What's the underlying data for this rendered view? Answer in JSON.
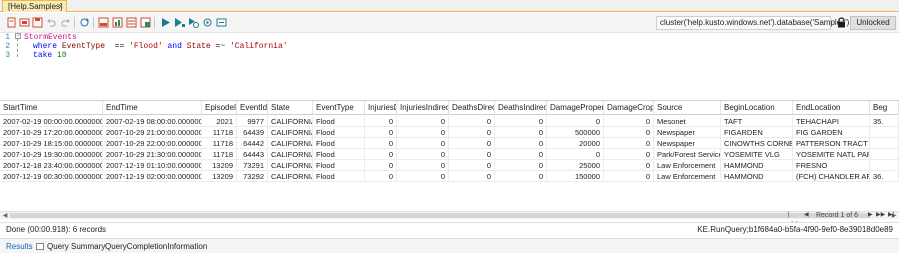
{
  "tab": {
    "title": "[Help.Samples]",
    "close": "×"
  },
  "toolbar": {
    "icons": [
      "new-query-icon",
      "open-icon",
      "save-icon",
      "undo-icon",
      "redo-icon",
      "refresh-icon",
      "export-icon",
      "chart-icon",
      "csv-icon",
      "excel-icon",
      "run-icon",
      "run-selection-icon",
      "run-explain-icon",
      "sync-icon",
      "settings-icon"
    ],
    "connection": "cluster('help.kusto.windows.net').database('Samples')",
    "unlock_label": "Unlocked"
  },
  "editor": {
    "line_numbers": [
      "1",
      "2",
      "3"
    ],
    "line1": {
      "table": "StormEvents"
    },
    "line2": {
      "kw_where": "where",
      "col1": "EventType",
      "op1": "==",
      "str1": "'Flood'",
      "kw_and": "and",
      "col2": "State",
      "op2": "=~",
      "str2": "'California'"
    },
    "line3": {
      "kw_take": "take",
      "num": "10"
    }
  },
  "grid": {
    "columns": [
      "StartTime",
      "EndTime",
      "EpisodeId",
      "EventId",
      "State",
      "EventType",
      "InjuriesDirect",
      "InjuriesIndirect",
      "DeathsDirect",
      "DeathsIndirect",
      "DamageProperty",
      "DamageCrops",
      "Source",
      "BeginLocation",
      "EndLocation",
      "Beg"
    ],
    "rows": [
      [
        "2007-02-19 00:00:00.0000000",
        "2007-02-19 08:00:00.0000000",
        "2021",
        "9977",
        "CALIFORNIA",
        "Flood",
        "0",
        "0",
        "0",
        "0",
        "0",
        "0",
        "Mesonet",
        "TAFT",
        "TEHACHAPI",
        "35."
      ],
      [
        "2007-10-29 17:20:00.0000000",
        "2007-10-29 21:00:00.0000000",
        "11718",
        "64439",
        "CALIFORNIA",
        "Flood",
        "0",
        "0",
        "0",
        "0",
        "500000",
        "0",
        "Newspaper",
        "FIGARDEN",
        "FIG GARDEN",
        ""
      ],
      [
        "2007-10-29 18:15:00.0000000",
        "2007-10-29 22:00:00.0000000",
        "11718",
        "64442",
        "CALIFORNIA",
        "Flood",
        "0",
        "0",
        "0",
        "0",
        "20000",
        "0",
        "Newspaper",
        "CINOWTHS CORNER",
        "PATTERSON TRACT",
        ""
      ],
      [
        "2007-10-29 19:30:00.0000000",
        "2007-10-29 21:30:00.0000000",
        "11718",
        "64443",
        "CALIFORNIA",
        "Flood",
        "0",
        "0",
        "0",
        "0",
        "0",
        "0",
        "Park/Forest Service",
        "YOSEMITE VLG",
        "YOSEMITE NATL PARK",
        ""
      ],
      [
        "2007-12-18 23:40:00.0000000",
        "2007-12-19 01:10:00.0000000",
        "13209",
        "73291",
        "CALIFORNIA",
        "Flood",
        "0",
        "0",
        "0",
        "0",
        "25000",
        "0",
        "Law Enforcement",
        "HAMMOND",
        "FRESNO",
        ""
      ],
      [
        "2007-12-19 00:30:00.0000000",
        "2007-12-19 02:00:00.0000000",
        "13209",
        "73292",
        "CALIFORNIA",
        "Flood",
        "0",
        "0",
        "0",
        "0",
        "150000",
        "0",
        "Law Enforcement",
        "HAMMOND",
        "(FCH) CHANDLER AF",
        "36."
      ]
    ],
    "pager_text": "Record 1 of 6"
  },
  "status": {
    "left": "Done (00:00.918): 6 records",
    "right": "KE.RunQuery;b1f684a0-b5fa-4f90-9ef0-8e39018d0e89"
  },
  "bottom_tabs": {
    "results": "Results",
    "query_summary": "Query Summary",
    "query_completion": "QueryCompletionInformation"
  },
  "colors": {
    "accent": "#1565c0",
    "tab_bg": "#fbe9b7",
    "keyword": "#0000ff",
    "string": "#b00000"
  }
}
